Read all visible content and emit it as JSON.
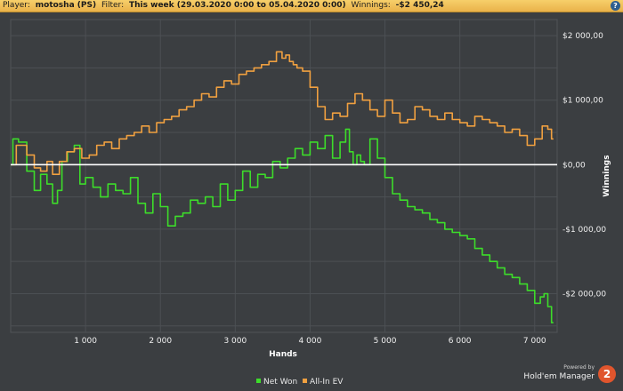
{
  "header": {
    "player_label": "Player:",
    "player_value": "motosha (PS)",
    "filter_label": "Filter:",
    "filter_value": "This week (29.03.2020 0:00 to 05.04.2020 0:00)",
    "winnings_label": "Winnings:",
    "winnings_value": "-$2 450,24",
    "help_glyph": "?"
  },
  "branding": {
    "powered_by": "Powered by",
    "product": "Hold'em Manager",
    "badge": "2"
  },
  "chart_data": {
    "type": "line",
    "xlabel": "Hands",
    "ylabel": "Winnings",
    "xlim": [
      0,
      7300
    ],
    "ylim": [
      -2600,
      2250
    ],
    "x_ticks": [
      1000,
      2000,
      3000,
      4000,
      5000,
      6000,
      7000
    ],
    "x_tick_labels": [
      "1 000",
      "2 000",
      "3 000",
      "4 000",
      "5 000",
      "6 000",
      "7 000"
    ],
    "y_ticks": [
      2000,
      1000,
      0,
      -1000,
      -2000
    ],
    "y_tick_labels": [
      "$2 000,00",
      "$1 000,00",
      "$0,00",
      "-$1 000,00",
      "-$2 000,00"
    ],
    "grid": true,
    "zero_line": true,
    "legend_position": "bottom-center",
    "series": [
      {
        "name": "Net Won",
        "color": "#3ddc2a",
        "x": [
          0,
          60,
          150,
          280,
          350,
          450,
          520,
          600,
          650,
          720,
          800,
          900,
          950,
          1050,
          1150,
          1250,
          1350,
          1450,
          1550,
          1650,
          1750,
          1850,
          1950,
          2050,
          2150,
          2250,
          2350,
          2450,
          2550,
          2650,
          2750,
          2850,
          2950,
          3050,
          3150,
          3250,
          3350,
          3450,
          3550,
          3650,
          3750,
          3850,
          3950,
          4050,
          4150,
          4250,
          4350,
          4450,
          4500,
          4550,
          4600,
          4650,
          4700,
          4750,
          4850,
          4950,
          5050,
          5150,
          5250,
          5350,
          5450,
          5550,
          5650,
          5750,
          5850,
          5950,
          6050,
          6150,
          6250,
          6350,
          6450,
          6550,
          6650,
          6750,
          6850,
          6950,
          7050,
          7100,
          7150,
          7200,
          7250
        ],
        "y": [
          0,
          400,
          350,
          -100,
          -400,
          -150,
          -300,
          -600,
          -400,
          50,
          200,
          300,
          -300,
          -200,
          -350,
          -500,
          -300,
          -400,
          -450,
          -200,
          -600,
          -750,
          -450,
          -650,
          -950,
          -800,
          -750,
          -550,
          -600,
          -500,
          -650,
          -300,
          -550,
          -400,
          -100,
          -350,
          -150,
          -200,
          50,
          -50,
          100,
          250,
          150,
          350,
          250,
          450,
          100,
          350,
          550,
          200,
          0,
          150,
          50,
          0,
          400,
          100,
          -200,
          -450,
          -550,
          -650,
          -700,
          -750,
          -850,
          -900,
          -1000,
          -1050,
          -1100,
          -1150,
          -1300,
          -1400,
          -1500,
          -1600,
          -1700,
          -1750,
          -1850,
          -1950,
          -2150,
          -2050,
          -2000,
          -2200,
          -2450
        ]
      },
      {
        "name": "All-In EV",
        "color": "#f0a040",
        "x": [
          0,
          150,
          280,
          350,
          450,
          520,
          600,
          700,
          800,
          900,
          1000,
          1100,
          1200,
          1300,
          1400,
          1500,
          1600,
          1700,
          1800,
          1900,
          2000,
          2100,
          2200,
          2300,
          2400,
          2500,
          2600,
          2700,
          2800,
          2900,
          3000,
          3100,
          3200,
          3300,
          3400,
          3500,
          3600,
          3650,
          3700,
          3750,
          3800,
          3850,
          3950,
          4050,
          4150,
          4250,
          4350,
          4450,
          4550,
          4650,
          4750,
          4850,
          4950,
          5050,
          5150,
          5250,
          5350,
          5450,
          5550,
          5650,
          5750,
          5850,
          5950,
          6050,
          6150,
          6250,
          6350,
          6450,
          6550,
          6650,
          6750,
          6850,
          6950,
          7050,
          7150,
          7200,
          7250
        ],
        "y": [
          0,
          300,
          150,
          -50,
          -100,
          50,
          -150,
          50,
          200,
          250,
          100,
          150,
          300,
          350,
          250,
          400,
          450,
          500,
          600,
          500,
          650,
          700,
          750,
          850,
          900,
          1000,
          1100,
          1050,
          1200,
          1300,
          1250,
          1400,
          1450,
          1500,
          1550,
          1600,
          1750,
          1650,
          1700,
          1600,
          1550,
          1500,
          1450,
          1200,
          900,
          700,
          800,
          750,
          950,
          1100,
          1000,
          850,
          750,
          1000,
          800,
          650,
          700,
          900,
          850,
          750,
          700,
          800,
          700,
          650,
          600,
          750,
          700,
          650,
          600,
          500,
          550,
          450,
          300,
          400,
          600,
          550,
          400
        ]
      }
    ]
  }
}
